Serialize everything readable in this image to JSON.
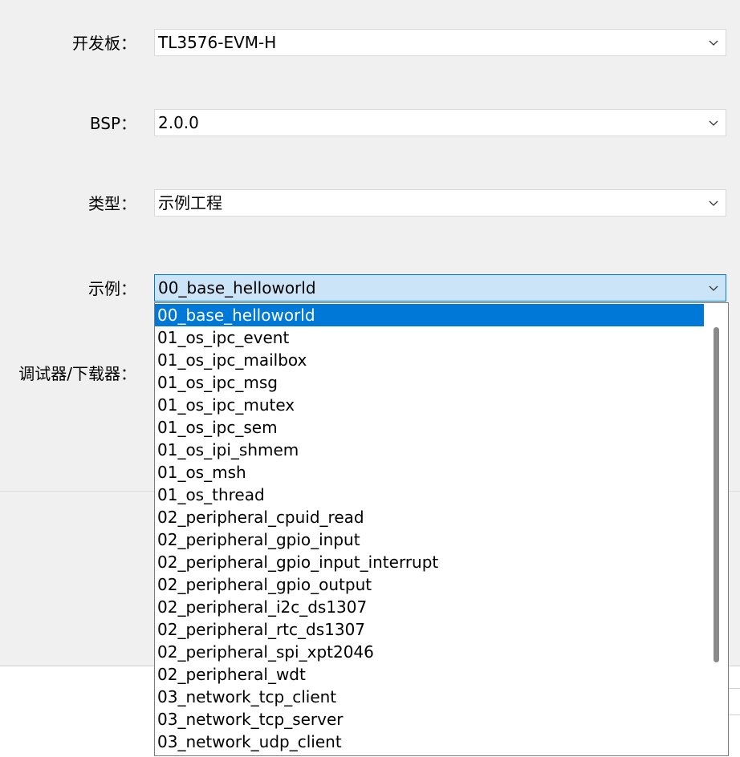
{
  "form": {
    "board": {
      "label": "开发板：",
      "value": "TL3576-EVM-H"
    },
    "bsp": {
      "label": "BSP：",
      "value": "2.0.0"
    },
    "type": {
      "label": "类型：",
      "value": "示例工程"
    },
    "example": {
      "label": "示例：",
      "value": "00_base_helloworld"
    },
    "debugger": {
      "label": "调试器/下载器："
    }
  },
  "dropdown": {
    "selected_index": 0,
    "options": [
      "00_base_helloworld",
      "01_os_ipc_event",
      "01_os_ipc_mailbox",
      "01_os_ipc_msg",
      "01_os_ipc_mutex",
      "01_os_ipc_sem",
      "01_os_ipi_shmem",
      "01_os_msh",
      "01_os_thread",
      "02_peripheral_cpuid_read",
      "02_peripheral_gpio_input",
      "02_peripheral_gpio_input_interrupt",
      "02_peripheral_gpio_output",
      "02_peripheral_i2c_ds1307",
      "02_peripheral_rtc_ds1307",
      "02_peripheral_spi_xpt2046",
      "02_peripheral_wdt",
      "03_network_tcp_client",
      "03_network_tcp_server",
      "03_network_udp_client"
    ]
  },
  "icons": {
    "combo_arrow": "chevron-down-icon"
  },
  "colors": {
    "selection": "#0078d7",
    "focused_field": "#cce4f7",
    "background": "#f0f0f0"
  }
}
